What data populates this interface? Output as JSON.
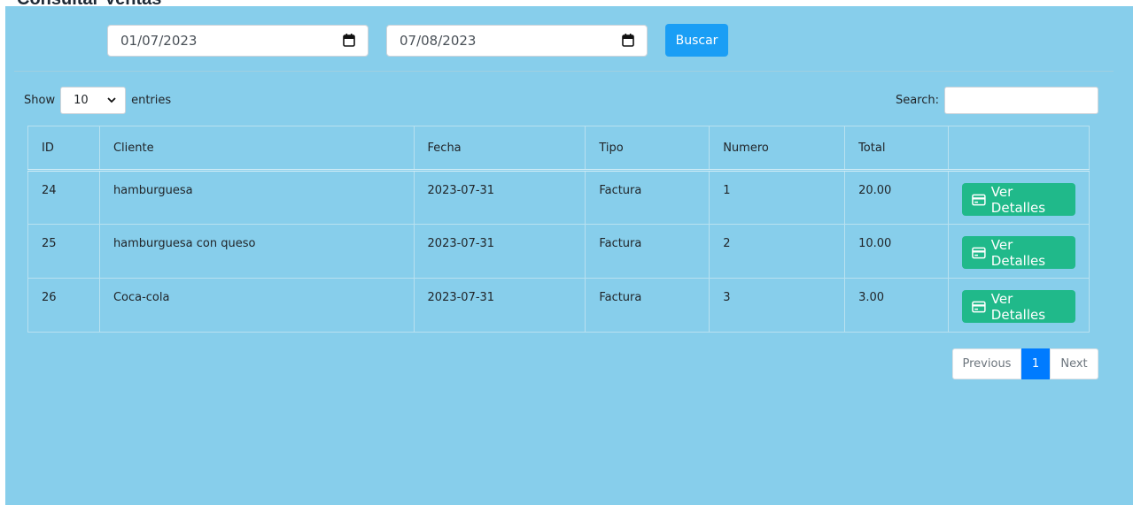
{
  "page": {
    "title": "Consultar Ventas"
  },
  "filters": {
    "date_from": "01/07/2023",
    "date_to": "07/08/2023",
    "search_button": "Buscar",
    "accent_color": "#1a9ef5"
  },
  "datatable": {
    "show_label": "Show",
    "entries_value": "10",
    "entries_label": "entries",
    "search_label": "Search:",
    "search_value": ""
  },
  "table": {
    "headers": [
      "ID",
      "Cliente",
      "Fecha",
      "Tipo",
      "Numero",
      "Total",
      ""
    ],
    "rows": [
      {
        "id": "24",
        "cliente": "hamburguesa",
        "fecha": "2023-07-31",
        "tipo": "Factura",
        "numero": "1",
        "total": "20.00",
        "action": "Ver Detalles"
      },
      {
        "id": "25",
        "cliente": "hamburguesa con queso",
        "fecha": "2023-07-31",
        "tipo": "Factura",
        "numero": "2",
        "total": "10.00",
        "action": "Ver Detalles"
      },
      {
        "id": "26",
        "cliente": "Coca-cola",
        "fecha": "2023-07-31",
        "tipo": "Factura",
        "numero": "3",
        "total": "3.00",
        "action": "Ver Detalles"
      }
    ],
    "action_color": "#20b98a"
  },
  "pagination": {
    "previous": "Previous",
    "current": "1",
    "next": "Next"
  },
  "colors": {
    "panel_background": "#87ceeb",
    "page_active": "#007bff"
  }
}
